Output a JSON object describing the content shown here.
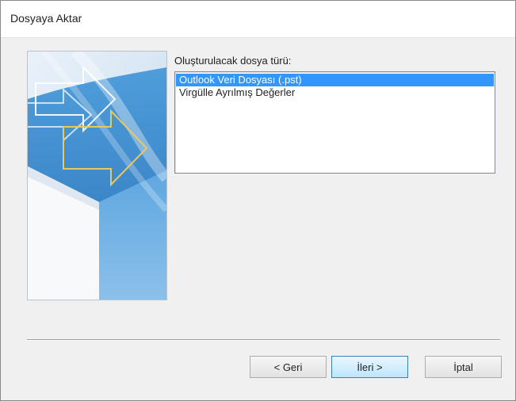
{
  "window": {
    "title": "Dosyaya Aktar"
  },
  "main": {
    "list_label": "Oluşturulacak dosya türü:",
    "file_types": [
      {
        "label": "Outlook Veri Dosyası (.pst)",
        "selected": true
      },
      {
        "label": "Virgülle Ayrılmış Değerler",
        "selected": false
      }
    ]
  },
  "buttons": {
    "back_label": "< Geri",
    "next_label": "İleri >",
    "cancel_label": "İptal"
  },
  "colors": {
    "selection": "#3297fd",
    "wizard_blue": "#2b7dc6",
    "arrow_outline": "#e8c860"
  },
  "icons": {
    "wizard_graphic": "export-arrows-graphic"
  }
}
